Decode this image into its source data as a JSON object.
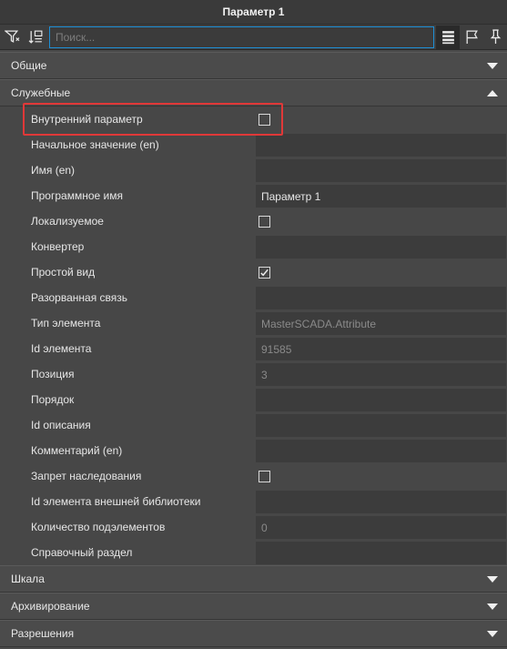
{
  "window": {
    "title": "Параметр 1"
  },
  "toolbar": {
    "search_placeholder": "Поиск...",
    "icons": [
      "filter-icon",
      "sort-icon",
      "list-view-icon",
      "flag-icon",
      "pin-icon"
    ]
  },
  "sections": {
    "general": {
      "label": "Общие"
    },
    "service": {
      "label": "Служебные"
    },
    "scale": {
      "label": "Шкала"
    },
    "archiving": {
      "label": "Архивирование"
    },
    "permissions": {
      "label": "Разрешения"
    }
  },
  "properties": [
    {
      "label": "Внутренний параметр",
      "type": "checkbox",
      "checked": false
    },
    {
      "label": "Начальное значение (en)",
      "type": "text",
      "value": ""
    },
    {
      "label": "Имя (en)",
      "type": "text",
      "value": ""
    },
    {
      "label": "Программное имя",
      "type": "text",
      "value": "Параметр 1"
    },
    {
      "label": "Локализуемое",
      "type": "checkbox",
      "checked": false
    },
    {
      "label": "Конвертер",
      "type": "text",
      "value": ""
    },
    {
      "label": "Простой вид",
      "type": "checkbox",
      "checked": true
    },
    {
      "label": "Разорванная связь",
      "type": "text",
      "value": ""
    },
    {
      "label": "Тип элемента",
      "type": "readonly",
      "value": "MasterSCADA.Attribute"
    },
    {
      "label": "Id элемента",
      "type": "readonly",
      "value": "91585"
    },
    {
      "label": "Позиция",
      "type": "readonly",
      "value": "3"
    },
    {
      "label": "Порядок",
      "type": "text",
      "value": ""
    },
    {
      "label": "Id описания",
      "type": "readonly",
      "value": ""
    },
    {
      "label": "Комментарий (en)",
      "type": "text",
      "value": ""
    },
    {
      "label": "Запрет наследования",
      "type": "checkbox",
      "checked": false
    },
    {
      "label": "Id элемента внешней библиотеки",
      "type": "readonly",
      "value": ""
    },
    {
      "label": "Количество подэлементов",
      "type": "readonly",
      "value": "0"
    },
    {
      "label": "Справочный раздел",
      "type": "text",
      "value": ""
    }
  ],
  "colors": {
    "accent": "#1e8fd6",
    "highlight": "#e03838",
    "background": "#4a4a4a"
  }
}
